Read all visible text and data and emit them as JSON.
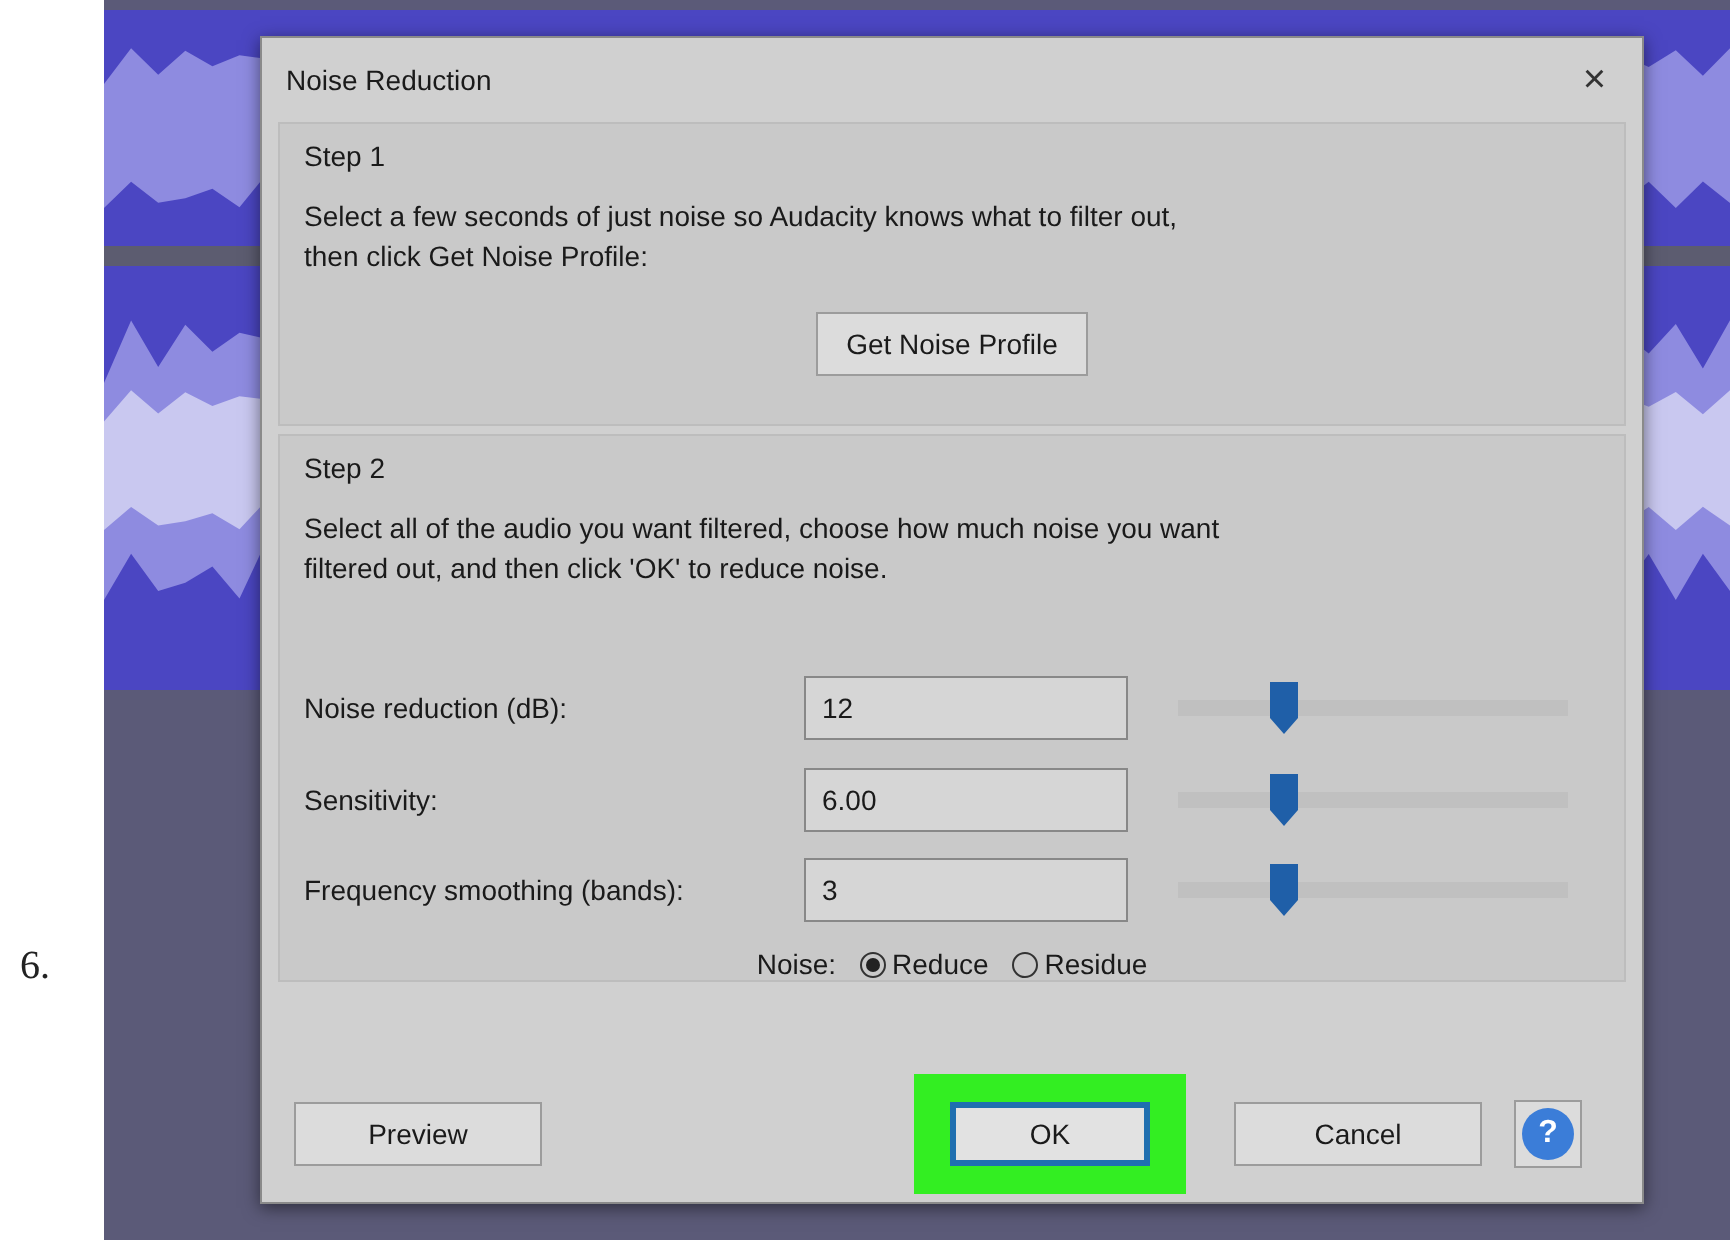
{
  "step_number": "6.",
  "window": {
    "title": "Noise Reduction",
    "close": "×"
  },
  "step1": {
    "heading": "Step 1",
    "text": "Select a few seconds of just noise so Audacity knows what to filter out,\nthen click Get Noise Profile:",
    "button": "Get Noise Profile"
  },
  "step2": {
    "heading": "Step 2",
    "text": "Select all of the audio you want filtered, choose how much noise you want\nfiltered out, and then click 'OK' to reduce noise.",
    "rows": [
      {
        "label": "Noise reduction (dB):",
        "value": "12",
        "level": 0.27
      },
      {
        "label": "Sensitivity:",
        "value": "6.00",
        "level": 0.27
      },
      {
        "label": "Frequency smoothing (bands):",
        "value": "3",
        "level": 0.27
      }
    ],
    "noise": {
      "label": "Noise:",
      "options": [
        {
          "label": "Reduce",
          "selected": true
        },
        {
          "label": "Residue",
          "selected": false
        }
      ]
    }
  },
  "buttons": [
    {
      "kind": "plain",
      "label": "Preview",
      "highlighted": false
    },
    {
      "kind": "default",
      "label": "OK",
      "highlighted": true
    },
    {
      "kind": "plain",
      "label": "Cancel",
      "highlighted": false
    },
    {
      "kind": "help",
      "label": "?",
      "highlighted": false
    }
  ]
}
